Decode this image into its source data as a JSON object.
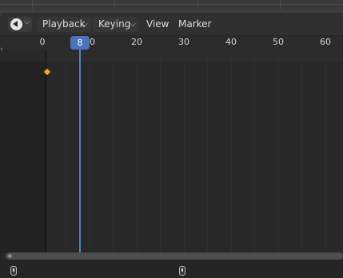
{
  "editor": {
    "type_icon": "clock-icon",
    "menus": {
      "playback": "Playback",
      "keying": "Keying",
      "view": "View",
      "marker": "Marker"
    }
  },
  "ruler": {
    "ticks": [
      "0",
      "10",
      "20",
      "30",
      "40",
      "50",
      "60"
    ]
  },
  "timeline": {
    "current_frame": "8",
    "keyframes": [
      1
    ],
    "keyframe_color": "#f3a92e",
    "playhead_color": "#4f81c7"
  }
}
